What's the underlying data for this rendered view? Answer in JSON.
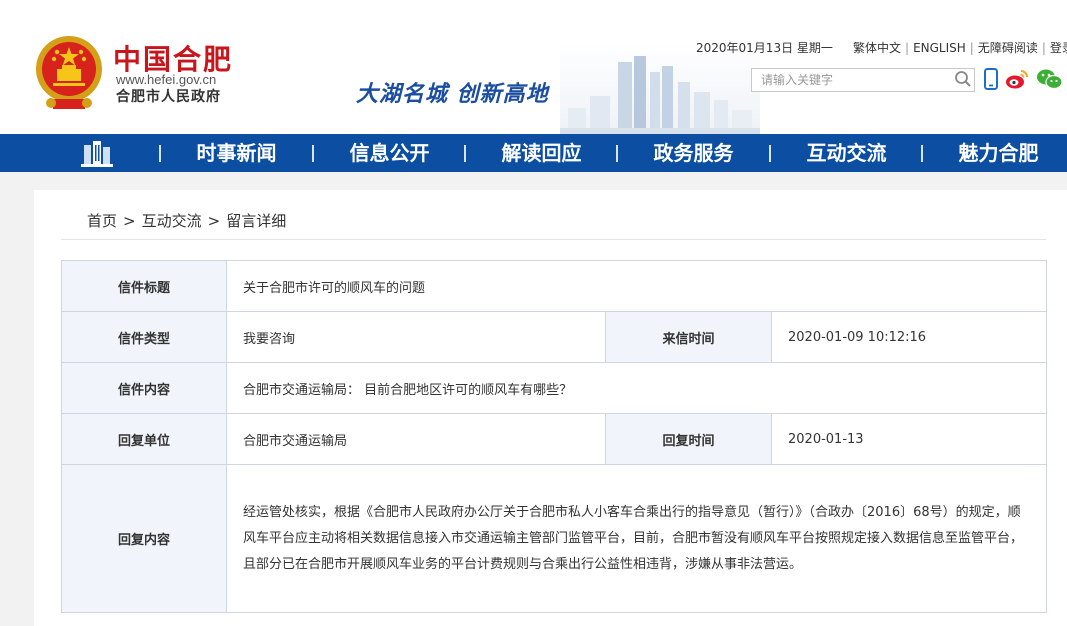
{
  "header": {
    "site_name": "中国合肥",
    "site_url": "www.hefei.gov.cn",
    "site_sub": "合肥市人民政府",
    "slogan": "大湖名城  创新高地",
    "date": "2020年01月13日 星期一",
    "links": [
      "繁体中文",
      "ENGLISH",
      "无障碍阅读",
      "登录"
    ],
    "search_placeholder": "请输入关键字",
    "icons": [
      "search-icon",
      "mobile-icon",
      "weibo-icon",
      "wechat-icon"
    ],
    "colors": {
      "brand_red": "#c8161d",
      "nav_blue": "#0b4ea2",
      "label_blue": "#1d4e9e"
    }
  },
  "nav": {
    "home_icon": "building-icon",
    "items": [
      "时事新闻",
      "信息公开",
      "解读回应",
      "政务服务",
      "互动交流",
      "魅力合肥"
    ]
  },
  "breadcrumb": {
    "items": [
      "首页",
      "互动交流",
      "留言详细"
    ],
    "separator": ">"
  },
  "letter": {
    "title_label": "信件标题",
    "title_value": "关于合肥市许可的顺风车的问题",
    "type_label": "信件类型",
    "type_value": "我要咨询",
    "time_label": "来信时间",
    "time_value": "2020-01-09 10:12:16",
    "content_label": "信件内容",
    "content_value": "合肥市交通运输局： 目前合肥地区许可的顺风车有哪些？",
    "reply_unit_label": "回复单位",
    "reply_unit_value": "合肥市交通运输局",
    "reply_time_label": "回复时间",
    "reply_time_value": "2020-01-13",
    "reply_content_label": "回复内容",
    "reply_content_value": "经运管处核实，根据《合肥市人民政府办公厅关于合肥市私人小客车合乘出行的指导意见（暂行）》（合政办〔2016〕68号）的规定，顺风车平台应主动将相关数据信息接入市交通运输主管部门监管平台，目前，合肥市暂没有顺风车平台按照规定接入数据信息至监管平台，且部分已在合肥市开展顺风车业务的平台计费规则与合乘出行公益性相违背，涉嫌从事非法营运。"
  }
}
